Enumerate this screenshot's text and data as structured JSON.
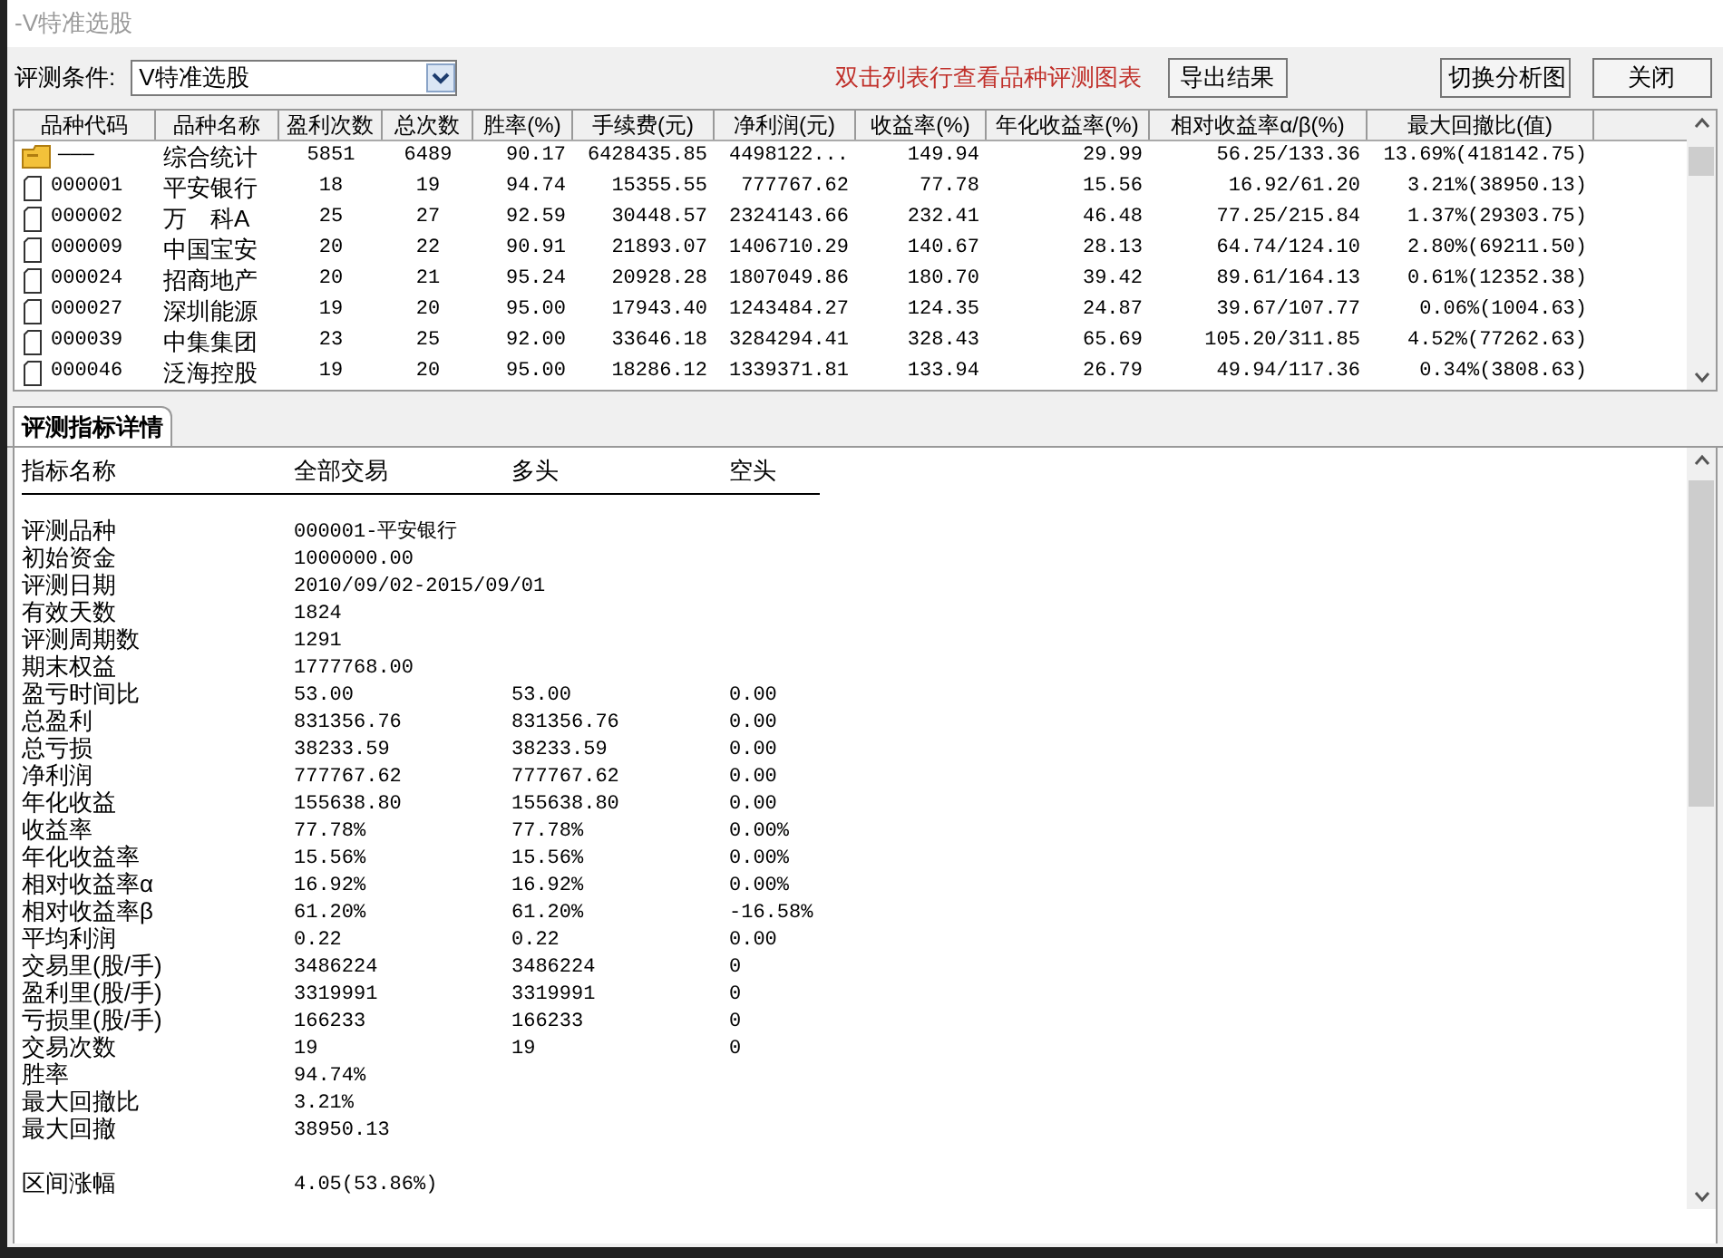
{
  "window": {
    "title": "-V特准选股"
  },
  "toolbar": {
    "condition_label": "评测条件:",
    "condition_value": "V特准选股",
    "hint": "双击列表行查看品种评测图表",
    "buttons": [
      "导出结果",
      "切换分析图",
      "关闭"
    ]
  },
  "table": {
    "columns": [
      "品种代码",
      "品种名称",
      "盈利次数",
      "总次数",
      "胜率(%)",
      "手续费(元)",
      "净利润(元)",
      "收益率(%)",
      "年化收益率(%)",
      "相对收益率α/β(%)",
      "最大回撤比(值)"
    ],
    "rows": [
      {
        "kind": "summary",
        "cells": [
          "———",
          "综合统计",
          "5851",
          "6489",
          "90.17",
          "6428435.85",
          "4498122...",
          "149.94",
          "29.99",
          "56.25/133.36",
          "13.69%(418142.75)"
        ]
      },
      {
        "kind": "stock",
        "cells": [
          "000001",
          "平安银行",
          "18",
          "19",
          "94.74",
          "15355.55",
          "777767.62",
          "77.78",
          "15.56",
          "16.92/61.20",
          "3.21%(38950.13)"
        ]
      },
      {
        "kind": "stock",
        "cells": [
          "000002",
          "万　科A",
          "25",
          "27",
          "92.59",
          "30448.57",
          "2324143.66",
          "232.41",
          "46.48",
          "77.25/215.84",
          "1.37%(29303.75)"
        ]
      },
      {
        "kind": "stock",
        "cells": [
          "000009",
          "中国宝安",
          "20",
          "22",
          "90.91",
          "21893.07",
          "1406710.29",
          "140.67",
          "28.13",
          "64.74/124.10",
          "2.80%(69211.50)"
        ]
      },
      {
        "kind": "stock",
        "cells": [
          "000024",
          "招商地产",
          "20",
          "21",
          "95.24",
          "20928.28",
          "1807049.86",
          "180.70",
          "39.42",
          "89.61/164.13",
          "0.61%(12352.38)"
        ]
      },
      {
        "kind": "stock",
        "cells": [
          "000027",
          "深圳能源",
          "19",
          "20",
          "95.00",
          "17943.40",
          "1243484.27",
          "124.35",
          "24.87",
          "39.67/107.77",
          "0.06%(1004.63)"
        ]
      },
      {
        "kind": "stock",
        "cells": [
          "000039",
          "中集集团",
          "23",
          "25",
          "92.00",
          "33646.18",
          "3284294.41",
          "328.43",
          "65.69",
          "105.20/311.85",
          "4.52%(77262.63)"
        ]
      },
      {
        "kind": "stock",
        "cells": [
          "000046",
          "泛海控股",
          "19",
          "20",
          "95.00",
          "18286.12",
          "1339371.81",
          "133.94",
          "26.79",
          "49.94/117.36",
          "0.34%(3808.63)"
        ]
      }
    ]
  },
  "tabs": [
    {
      "label": "评测指标详情",
      "selected": true
    }
  ],
  "detail": {
    "columns": [
      "指标名称",
      "全部交易",
      "多头",
      "空头"
    ],
    "rows": [
      {
        "kind": "row",
        "cells": [
          "评测品种",
          "000001-平安银行"
        ]
      },
      {
        "kind": "row",
        "cells": [
          "初始资金",
          "1000000.00"
        ]
      },
      {
        "kind": "row",
        "cells": [
          "评测日期",
          "2010/09/02-2015/09/01"
        ]
      },
      {
        "kind": "row",
        "cells": [
          "有效天数",
          "1824"
        ]
      },
      {
        "kind": "row",
        "cells": [
          "评测周期数",
          "1291"
        ]
      },
      {
        "kind": "row",
        "cells": [
          "期末权益",
          "1777768.00"
        ]
      },
      {
        "kind": "row",
        "cells": [
          "盈亏时间比",
          "53.00",
          "53.00",
          "0.00"
        ]
      },
      {
        "kind": "row",
        "cells": [
          "总盈利",
          "831356.76",
          "831356.76",
          "0.00"
        ]
      },
      {
        "kind": "row",
        "cells": [
          "总亏损",
          "38233.59",
          "38233.59",
          "0.00"
        ]
      },
      {
        "kind": "row",
        "cells": [
          "净利润",
          "777767.62",
          "777767.62",
          "0.00"
        ]
      },
      {
        "kind": "row",
        "cells": [
          "年化收益",
          "155638.80",
          "155638.80",
          "0.00"
        ]
      },
      {
        "kind": "row",
        "cells": [
          "收益率",
          "77.78%",
          "77.78%",
          "0.00%"
        ]
      },
      {
        "kind": "row",
        "cells": [
          "年化收益率",
          "15.56%",
          "15.56%",
          "0.00%"
        ]
      },
      {
        "kind": "row",
        "cells": [
          "相对收益率α",
          "16.92%",
          "16.92%",
          "0.00%"
        ]
      },
      {
        "kind": "row",
        "cells": [
          "相对收益率β",
          "61.20%",
          "61.20%",
          "-16.58%"
        ]
      },
      {
        "kind": "row",
        "cells": [
          "平均利润",
          "0.22",
          "0.22",
          "0.00"
        ]
      },
      {
        "kind": "row",
        "cells": [
          "交易里(股/手)",
          "3486224",
          "3486224",
          "0"
        ]
      },
      {
        "kind": "row",
        "cells": [
          "盈利里(股/手)",
          "3319991",
          "3319991",
          "0"
        ]
      },
      {
        "kind": "row",
        "cells": [
          "亏损里(股/手)",
          "166233",
          "166233",
          "0"
        ]
      },
      {
        "kind": "row",
        "cells": [
          "交易次数",
          "19",
          "19",
          "0"
        ]
      },
      {
        "kind": "row",
        "cells": [
          "胜率",
          "94.74%"
        ]
      },
      {
        "kind": "row",
        "cells": [
          "最大回撤比",
          "3.21%"
        ]
      },
      {
        "kind": "row",
        "cells": [
          "最大回撤",
          "38950.13"
        ]
      },
      {
        "kind": "gap"
      },
      {
        "kind": "row",
        "cells": [
          "区间涨幅",
          "4.05(53.86%)"
        ]
      }
    ]
  }
}
